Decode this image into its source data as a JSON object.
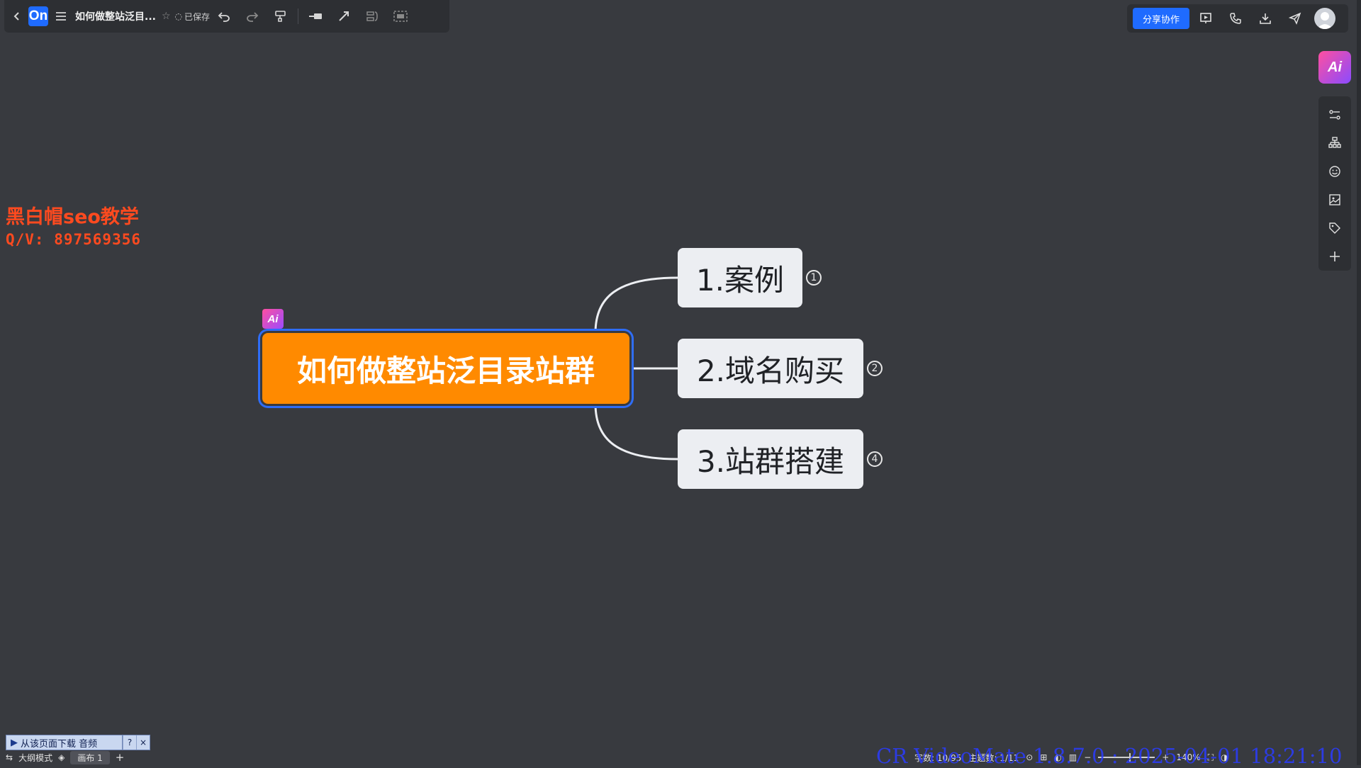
{
  "toolbar": {
    "logo": "On",
    "doc_title": "如何做整站泛目...",
    "saved_label": "已保存",
    "icons": [
      "back-icon",
      "menu-icon",
      "star-icon",
      "undo-icon",
      "redo-icon",
      "format-painter-icon",
      "insert-topic-icon",
      "connection-icon",
      "summary-icon",
      "frame-icon"
    ]
  },
  "top_right": {
    "share_label": "分享协作",
    "icons": [
      "presentation-icon",
      "call-icon",
      "download-icon",
      "send-icon",
      "avatar"
    ]
  },
  "sidebar": {
    "ai_label": "Ai",
    "icons": [
      "style-icon",
      "structure-icon",
      "emoji-icon",
      "image-icon",
      "tag-icon",
      "add-icon"
    ]
  },
  "watermark": {
    "line1": "黑白帽seo教学",
    "line2": "Q/V: 897569356"
  },
  "mindmap": {
    "root": {
      "label": "如何做整站泛目录站群",
      "ai_badge": "Ai",
      "color": "#ff8a00"
    },
    "branches": [
      {
        "label": "1.案例",
        "badge": "1"
      },
      {
        "label": "2.域名购买",
        "badge": "2"
      },
      {
        "label": "3.站群搭建",
        "badge": "4"
      }
    ]
  },
  "bottom": {
    "download_bar": "从该页面下载 音频",
    "download_help": "?",
    "download_close": "×",
    "outline_mode": "大纲模式",
    "canvas_tab": "画布 1",
    "add": "+",
    "word_count": "字数: 10/95",
    "topic_count": "主题数: 1/11",
    "zoom": "140%",
    "overlay": "CR VideoMate 1.8.7.0 : 2025-04-01 18:21:10"
  }
}
